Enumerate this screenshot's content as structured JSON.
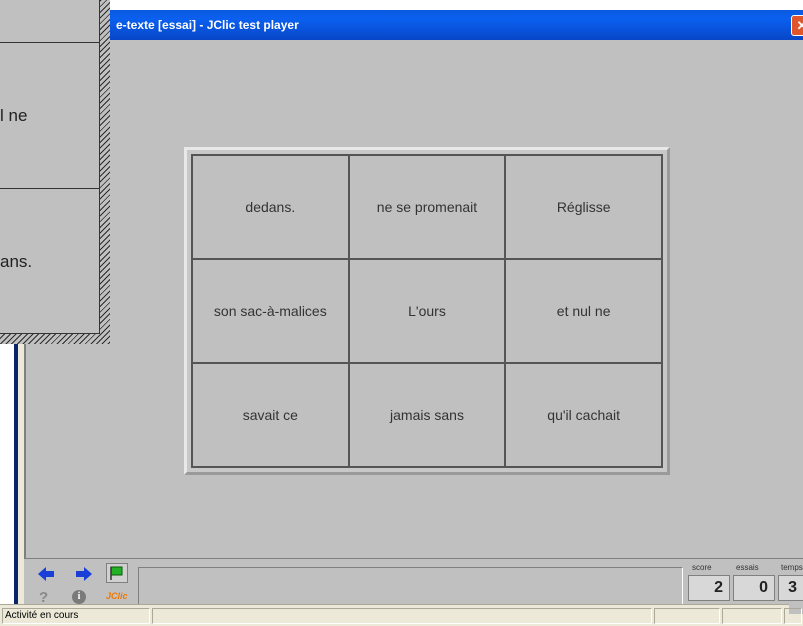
{
  "window": {
    "title": "e-texte [essai] - JClic test player",
    "close_glyph": "✕"
  },
  "puzzle": {
    "cells": [
      "dedans.",
      "ne se promenait",
      "Réglisse",
      "son sac-à-malices",
      "L'ours",
      "et nul ne",
      "savait ce",
      "jamais sans",
      "qu'il cachait"
    ]
  },
  "floater": {
    "cells": [
      "",
      "l ne",
      "ans."
    ]
  },
  "controls": {
    "help_glyph": "?",
    "info_glyph": "i",
    "logo": "JClic",
    "score_label": "score",
    "essais_label": "essais",
    "temps_label": "temps",
    "score": "2",
    "essais": "0",
    "temps": "3"
  },
  "status": {
    "text": "Activité en cours"
  },
  "colors": {
    "titlebar": "#0b5ae0",
    "arrow_blue": "#1a3fd8",
    "flag_green": "#24b024",
    "logo_orange": "#f07800"
  }
}
